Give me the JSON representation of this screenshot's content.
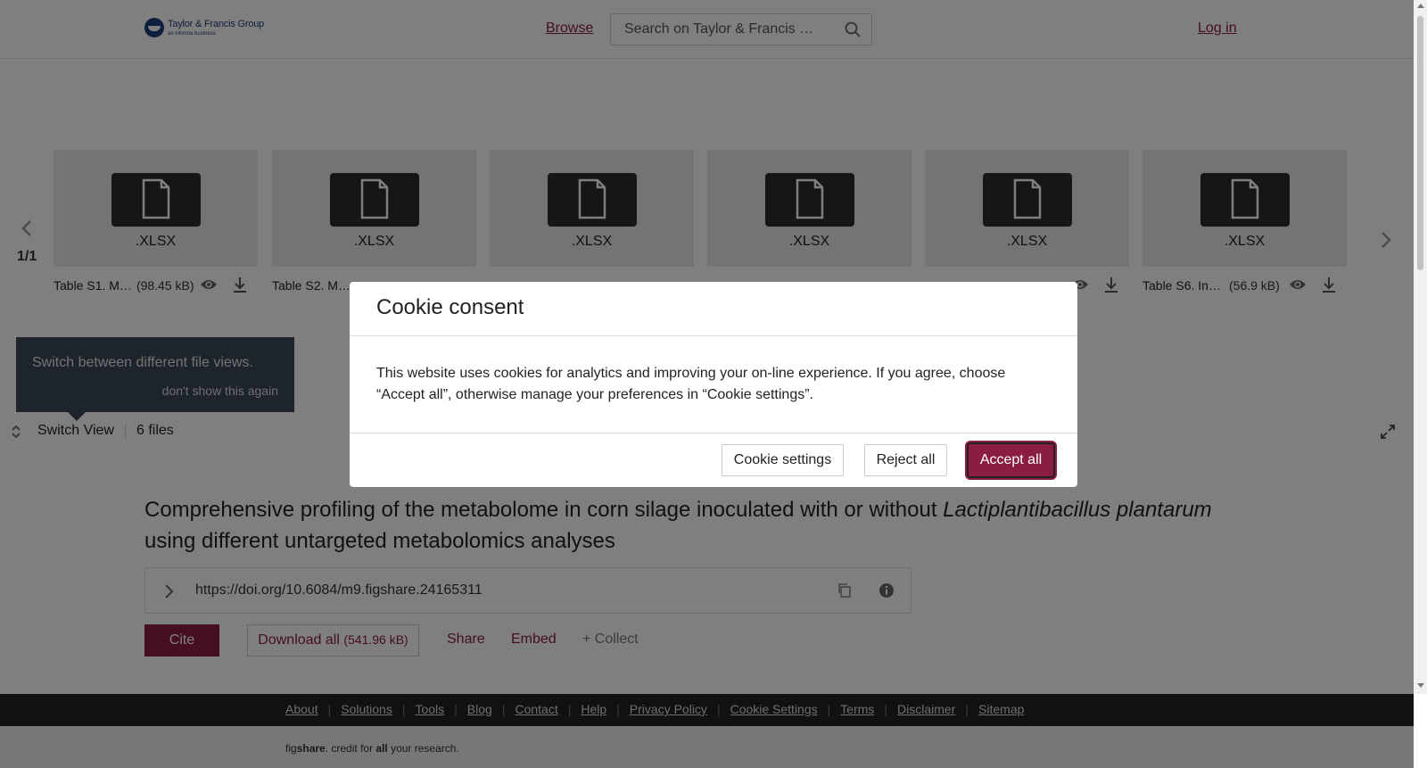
{
  "header": {
    "logo_main": "Taylor & Francis Group",
    "logo_sub": "an informa business",
    "browse_label": "Browse",
    "search_placeholder": "Search on Taylor & Francis …",
    "login_label": "Log in"
  },
  "carousel": {
    "pager": "1/1",
    "files": [
      {
        "ext": ".XLSX",
        "name": "Table S1. M…",
        "size": "(98.45 kB)"
      },
      {
        "ext": ".XLSX",
        "name": "Table S2. M…",
        "size": ""
      },
      {
        "ext": ".XLSX",
        "name": "",
        "size": ""
      },
      {
        "ext": ".XLSX",
        "name": "",
        "size": ""
      },
      {
        "ext": ".XLSX",
        "name": "",
        "size": ""
      },
      {
        "ext": ".XLSX",
        "name": "Table S6. Inc…",
        "size": "(56.9 kB)"
      }
    ],
    "tooltip_text": "Switch between different file views.",
    "tooltip_dismiss": "don't show this again",
    "switch_view_label": "Switch View",
    "files_count": "6 files"
  },
  "item": {
    "title_part1": "Comprehensive profiling of the metabolome in corn silage inoculated with or without ",
    "title_italic": "Lactiplantibacillus plantarum",
    "title_part2": " using different untargeted metabolomics analyses",
    "doi": "https://doi.org/10.6084/m9.figshare.24165311",
    "cite_label": "Cite",
    "download_label": "Download all",
    "download_size": "(541.96 kB)",
    "share_label": "Share",
    "embed_label": "Embed",
    "collect_label": "+ Collect"
  },
  "footer": {
    "links": [
      "About",
      "Solutions",
      "Tools",
      "Blog",
      "Contact",
      "Help",
      "Privacy Policy",
      "Cookie Settings",
      "Terms",
      "Disclaimer",
      "Sitemap"
    ],
    "tagline_fig": "fig",
    "tagline_share": "share",
    "tagline_mid": ". credit for ",
    "tagline_all": "all",
    "tagline_end": " your research."
  },
  "cookie_modal": {
    "title": "Cookie consent",
    "body": "This website uses cookies for analytics and improving your on-line experience. If you agree, choose “Accept all”, otherwise manage your preferences in “Cookie settings”.",
    "settings_label": "Cookie settings",
    "reject_label": "Reject all",
    "accept_label": "Accept all"
  },
  "colors": {
    "accent": "#8b1d42",
    "overlay": "rgba(0,0,0,0.5)"
  },
  "icons": [
    "search-icon",
    "chevron-left-icon",
    "chevron-right-icon",
    "file-icon",
    "eye-icon",
    "download-icon",
    "switch-view-icon",
    "expand-icon",
    "chevron-right-icon",
    "copy-icon",
    "info-icon"
  ]
}
